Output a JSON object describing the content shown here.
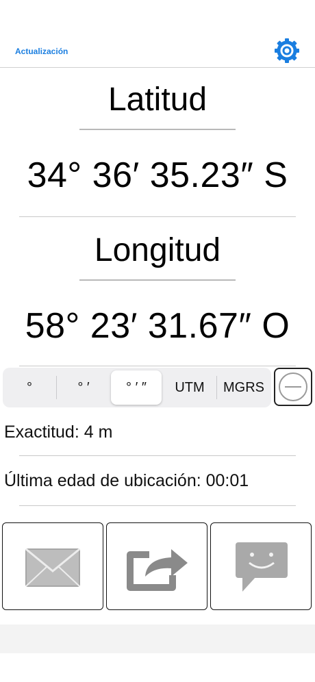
{
  "header": {
    "update_label": "Actualización",
    "settings_icon": "gear-icon",
    "accent": "#1a7ee0"
  },
  "latitude": {
    "label": "Latitud",
    "value": "34° 36′ 35.23″ S"
  },
  "longitude": {
    "label": "Longitud",
    "value": "58° 23′ 31.67″ O"
  },
  "formats": {
    "options": [
      "°",
      "° ′",
      "° ′ ″",
      "UTM",
      "MGRS"
    ],
    "selected": "° ′ ″"
  },
  "info": {
    "accuracy": "Exactitud: 4 m",
    "location_age": "Última edad de ubicación: 00:01"
  },
  "actions": {
    "icons": [
      "mail-icon",
      "share-icon",
      "message-icon"
    ]
  }
}
